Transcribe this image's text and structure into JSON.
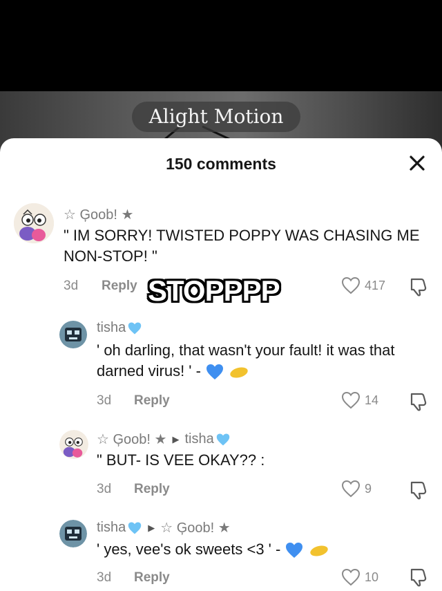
{
  "video": {
    "watermark": "Alight Motion"
  },
  "sheet": {
    "title": "150 comments"
  },
  "comments": [
    {
      "username": "☆ Ģoob! ★",
      "text": "\" IM SORRY! TWISTED POPPY WAS CHASING ME NON-STOP! \"",
      "time": "3d",
      "reply_label": "Reply",
      "likes": "417",
      "sticker": "STOPPPP"
    },
    {
      "username": "tisha",
      "text": "' oh darling, that wasn't your fault! it was that darned virus! ' -",
      "time": "3d",
      "reply_label": "Reply",
      "likes": "14"
    },
    {
      "username": "☆ Ģoob! ★",
      "reply_to": "tisha",
      "text": "\" BUT- IS VEE OKAY?? :",
      "time": "3d",
      "reply_label": "Reply",
      "likes": "9"
    },
    {
      "username": "tisha",
      "reply_to": "☆ Ģoob! ★",
      "text": "' yes, vee's ok sweets <3 ' -",
      "time": "3d",
      "reply_label": "Reply",
      "likes": "10"
    }
  ],
  "colors": {
    "blue_heart": "#3f8ff0",
    "light_blue_heart": "#6ec3f5",
    "sponge": "#f2c22e"
  }
}
